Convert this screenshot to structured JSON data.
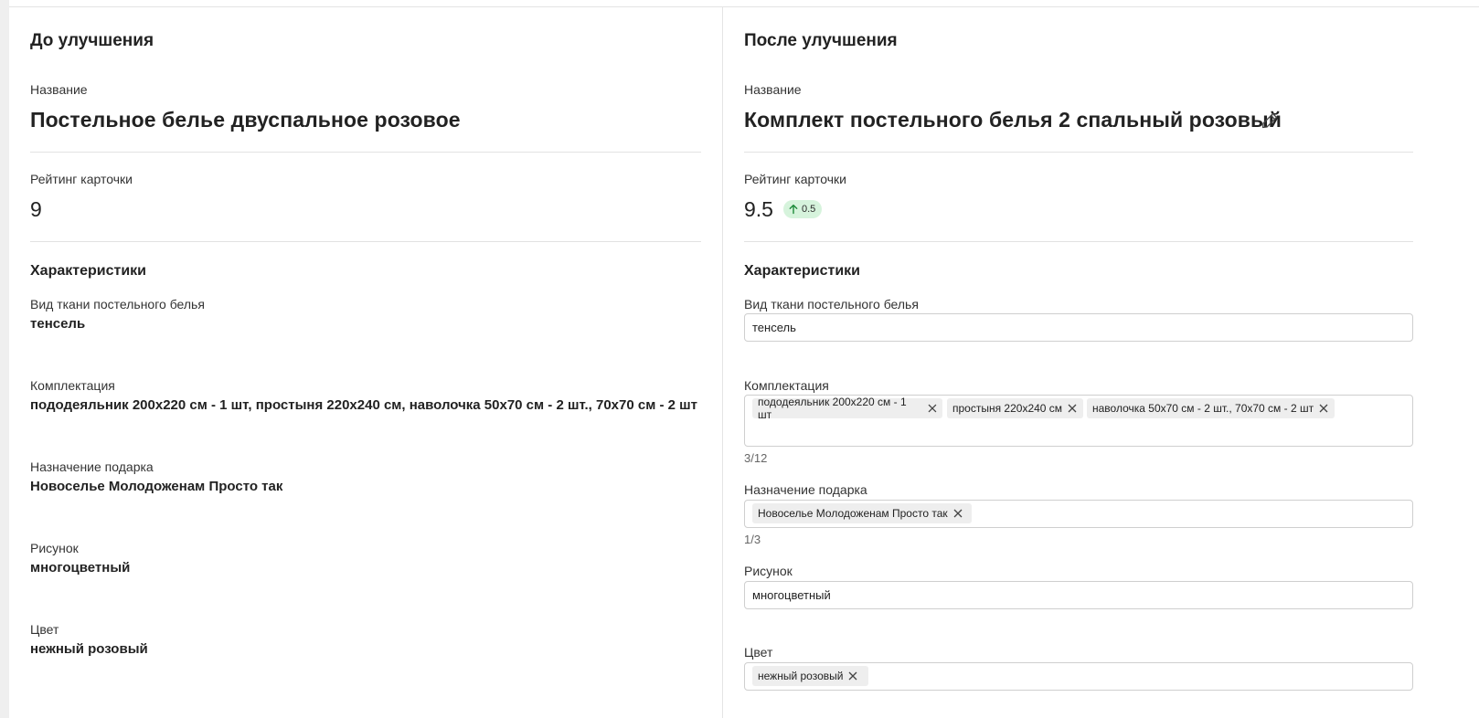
{
  "left": {
    "title": "До улучшения",
    "name_label": "Название",
    "name_value": "Постельное белье двуспальное розовое",
    "rating_label": "Рейтинг карточки",
    "rating_value": "9",
    "characteristics_title": "Характеристики",
    "fields": [
      {
        "label": "Вид ткани постельного белья",
        "value": "тенсель"
      },
      {
        "label": "Комплектация",
        "value": "пододеяльник 200x220 см - 1 шт, простыня 220x240 см, наволочка 50x70 см - 2 шт., 70x70 см - 2 шт"
      },
      {
        "label": "Назначение подарка",
        "value": "Новоселье Молодоженам Просто так"
      },
      {
        "label": "Рисунок",
        "value": "многоцветный"
      },
      {
        "label": "Цвет",
        "value": "нежный розовый"
      }
    ]
  },
  "right": {
    "title": "После улучшения",
    "name_label": "Название",
    "name_value": "Комплект постельного белья 2 спальный розовый",
    "edit_icon": "pencil-icon",
    "rating_label": "Рейтинг карточки",
    "rating_value": "9.5",
    "rating_delta": "0.5",
    "rating_delta_icon": "arrow-up-icon",
    "characteristics_title": "Характеристики",
    "fabric": {
      "label": "Вид ткани постельного белья",
      "value": "тенсель"
    },
    "set": {
      "label": "Комплектация",
      "chips": [
        "пододеяльник 200x220 см - 1 шт",
        "простыня 220x240 см",
        "наволочка 50x70 см - 2 шт., 70x70 см - 2 шт"
      ],
      "counter": "3/12"
    },
    "gift": {
      "label": "Назначение подарка",
      "chips": [
        "Новоселье Молодоженам Просто так"
      ],
      "counter": "1/3"
    },
    "pattern": {
      "label": "Рисунок",
      "value": "многоцветный"
    },
    "color": {
      "label": "Цвет",
      "chips": [
        "нежный розовый"
      ]
    }
  },
  "colors": {
    "badge_bg": "#d6f3dc",
    "badge_arrow": "#1e8a3a",
    "chip_bg": "#eeeeee",
    "border": "#cfcfcf"
  }
}
